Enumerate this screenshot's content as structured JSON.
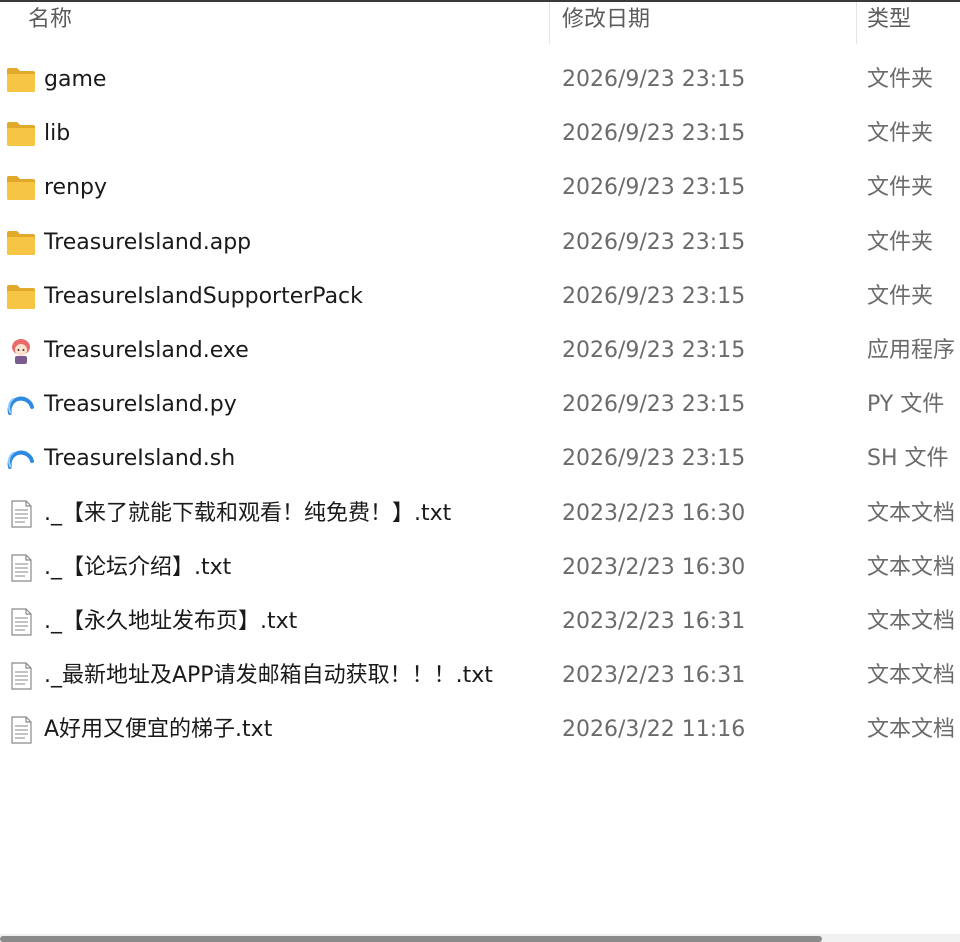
{
  "columns": {
    "name": "名称",
    "date": "修改日期",
    "type": "类型"
  },
  "files": [
    {
      "name": "game",
      "date": "2026/9/23 23:15",
      "type": "文件夹",
      "icon": "folder-icon"
    },
    {
      "name": "lib",
      "date": "2026/9/23 23:15",
      "type": "文件夹",
      "icon": "folder-icon"
    },
    {
      "name": "renpy",
      "date": "2026/9/23 23:15",
      "type": "文件夹",
      "icon": "folder-icon"
    },
    {
      "name": "TreasureIsland.app",
      "date": "2026/9/23 23:15",
      "type": "文件夹",
      "icon": "folder-icon"
    },
    {
      "name": "TreasureIslandSupporterPack",
      "date": "2026/9/23 23:15",
      "type": "文件夹",
      "icon": "folder-icon"
    },
    {
      "name": "TreasureIsland.exe",
      "date": "2026/9/23 23:15",
      "type": "应用程序",
      "icon": "app-character-icon"
    },
    {
      "name": "TreasureIsland.py",
      "date": "2026/9/23 23:15",
      "type": "PY 文件",
      "icon": "script-ring-icon"
    },
    {
      "name": "TreasureIsland.sh",
      "date": "2026/9/23 23:15",
      "type": "SH 文件",
      "icon": "script-ring-icon"
    },
    {
      "name": "._【来了就能下载和观看！纯免费！】.txt",
      "date": "2023/2/23 16:30",
      "type": "文本文档",
      "icon": "text-file-icon"
    },
    {
      "name": "._【论坛介绍】.txt",
      "date": "2023/2/23 16:30",
      "type": "文本文档",
      "icon": "text-file-icon"
    },
    {
      "name": "._【永久地址发布页】.txt",
      "date": "2023/2/23 16:31",
      "type": "文本文档",
      "icon": "text-file-icon"
    },
    {
      "name": "._最新地址及APP请发邮箱自动获取！！！.txt",
      "date": "2023/2/23 16:31",
      "type": "文本文档",
      "icon": "text-file-icon"
    },
    {
      "name": "A好用又便宜的梯子.txt",
      "date": "2026/3/22 11:16",
      "type": "文本文档",
      "icon": "text-file-icon"
    }
  ],
  "colors": {
    "folder": "#f5c543",
    "folder_dark": "#e0a92c",
    "ring": "#2f8be0",
    "date_text": "#6b6b6b"
  }
}
